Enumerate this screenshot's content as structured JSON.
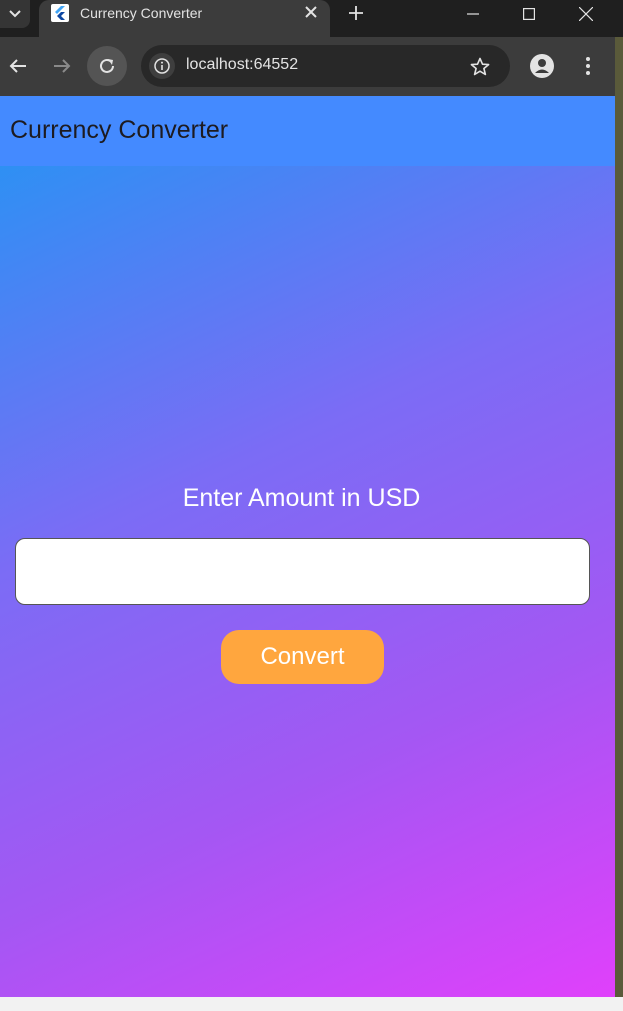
{
  "browser": {
    "tab_title": "Currency Converter",
    "url": "localhost:64552",
    "icons": {
      "tab_search": "chevron-down-icon",
      "favicon": "flutter-icon",
      "tab_close": "close-icon",
      "new_tab": "plus-icon",
      "minimize": "minimize-icon",
      "maximize": "maximize-icon",
      "window_close": "close-icon",
      "back": "arrow-left-icon",
      "forward": "arrow-right-icon",
      "reload": "reload-icon",
      "site_info": "info-icon",
      "bookmark": "star-icon",
      "profile": "profile-icon",
      "menu": "more-vertical-icon"
    }
  },
  "app": {
    "title": "Currency Converter",
    "amount_label": "Enter Amount in USD",
    "amount_value": "",
    "convert_label": "Convert",
    "colors": {
      "appbar": "#448aff",
      "gradient_start": "#2196f3",
      "gradient_end": "#e040fb",
      "button": "#ffa63e"
    }
  }
}
